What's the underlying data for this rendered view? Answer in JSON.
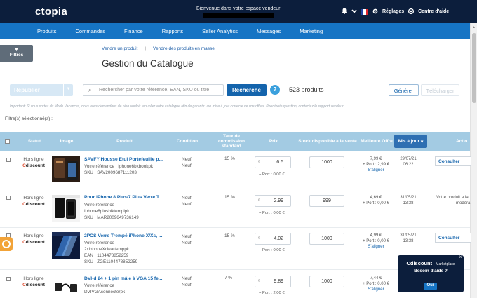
{
  "header": {
    "logo": "cdiscount-logo",
    "logo_text": "ctopia",
    "welcome": "Bienvenue dans votre espace vendeur",
    "settings": "Réglages",
    "help_center": "Centre d'aide",
    "flag_colors": [
      "#1f3fa0",
      "#ffffff",
      "#e3242b"
    ]
  },
  "nav": [
    "Produits",
    "Commandes",
    "Finance",
    "Rapports",
    "Seller Analytics",
    "Messages",
    "Marketing"
  ],
  "sidebar": {
    "filters": "Filtres"
  },
  "links": {
    "sell": "Vendre un produit",
    "sep": "|",
    "sell_bulk": "Vendre des produits en masse"
  },
  "page_title": "Gestion du Catalogue",
  "toolbar": {
    "publish": "Republier",
    "search_placeholder": "Rechercher par votre référence, EAN, SKU ou titre",
    "search_btn": "Recherche",
    "help": "?",
    "count": "523 produits",
    "generate": "Générer",
    "download": "Télécharger"
  },
  "notice": "Important: Si vous sortez du Mode Vacances, nous vous demandons de bien vouloir republier votre catalogue afin de garantir une mise à jour correcte de vos offres. Pour toute question, contactez le support vendeur",
  "filters_selected": "Filtre(s) sélectionné(s) :",
  "table": {
    "headers": {
      "status": "Statut",
      "image": "Image",
      "product": "Produit",
      "condition": "Condition",
      "commission": "Taux de commission standard",
      "price": "Prix",
      "stock": "Stock disponible à la vente",
      "best_offer": "Meilleure Offre",
      "updated": "Mis à jour",
      "actions": "Actio"
    },
    "rows": [
      {
        "status1": "Hors ligne",
        "status2": "discount",
        "status_c": "C",
        "title": "SAVFY Housse Etui Portefeuille p...",
        "ref_label": "Votre référence : Iphone6bkbookpk",
        "ean": "",
        "sku": "SKU : SAV2009687111203",
        "cond1": "Neuf",
        "cond2": "Neuf",
        "rate": "15 %",
        "price": "6.5",
        "currency": "€",
        "port": "+ Port : 0,00 €",
        "stock": "1000",
        "bo1": "7,99 €",
        "bo2": "+ Port : 2,99 €",
        "bo3": "S'aligner",
        "upd1": "29/07/21",
        "upd2": "06:22",
        "action": "Consulter"
      },
      {
        "status1": "Hors ligne",
        "status2": "discount",
        "status_c": "C",
        "title": "Pour iPhone 8 Plus/7 Plus Verre T...",
        "ref_label": "Votre référence :",
        "ref_value": "Iphone8plusblktempipk",
        "ean": "",
        "sku": "SKU : MAR2009649736149",
        "cond1": "Neuf",
        "cond2": "Neuf",
        "rate": "15 %",
        "price": "2.99",
        "currency": "€",
        "port": "+ Port : 0,00 €",
        "stock": "999",
        "bo1": "4,69 €",
        "bo2": "+ Port : 0,00 €",
        "bo3": "",
        "upd1": "31/05/21",
        "upd2": "13:38",
        "action": "Votre produit a fa",
        "action2": "modéra"
      },
      {
        "status1": "Hors ligne",
        "status2": "discount",
        "status_c": "C",
        "title": "2PCS Verre Trempé iPhone X/Xs, ...",
        "ref_label": "Votre référence :",
        "ref_value": "2xiphoneXcleartemppk",
        "ean": "EAN : 1104478852259",
        "sku": "SKU : ZGE1104478852259",
        "cond1": "Neuf",
        "cond2": "Neuf",
        "rate": "15 %",
        "price": "4.02",
        "currency": "€",
        "port": "+ Port : 0,00 €",
        "stock": "1000",
        "bo1": "4,99 €",
        "bo2": "+ Port : 0,00 €",
        "bo3": "S'aligner",
        "upd1": "31/05/21",
        "upd2": "13:38",
        "action": "Consulter"
      },
      {
        "status1": "Hors ligne",
        "status2": "discount",
        "status_c": "C",
        "title": "DVI-d 24 + 1 pin mâle à VGA 15 fe...",
        "ref_label": "Votre référence :",
        "ref_value": "DVIVGAconnecterpk",
        "ean": "",
        "sku": "",
        "cond1": "Neuf",
        "cond2": "Neuf",
        "rate": "7 %",
        "price": "9.89",
        "currency": "€",
        "port": "+ Port : 2,00 €",
        "stock": "1000",
        "bo1": "7,44 €",
        "bo2": "+ Port : 0,00 €",
        "bo3": "S'aligner",
        "upd1": "",
        "upd2": "",
        "action": ""
      }
    ]
  },
  "popup": {
    "title": "Cdiscount",
    "subtitle": "- Marketplace",
    "question": "Besoin d'aide ?",
    "yes": "Oui",
    "close": "x"
  }
}
